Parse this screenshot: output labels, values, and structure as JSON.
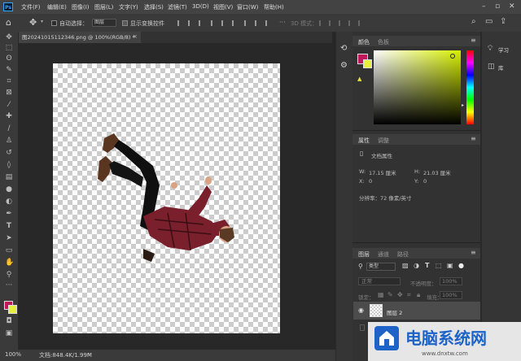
{
  "menu": {
    "logo": "Ps",
    "items": [
      "文件(F)",
      "编辑(E)",
      "图像(I)",
      "图层(L)",
      "文字(Y)",
      "选择(S)",
      "滤镜(T)",
      "3D(D)",
      "视图(V)",
      "窗口(W)",
      "帮助(H)"
    ]
  },
  "options": {
    "auto_select_label": "自动选择：",
    "auto_select_value": "图层",
    "show_transform_label": "显示变换控件",
    "mode_3d_label": "3D 模式："
  },
  "document": {
    "tab_title": "图20241015112346.png @ 100%(RGB/8) *"
  },
  "status": {
    "zoom": "100%",
    "doc_info": "文档:848.4K/1.99M"
  },
  "color_panel": {
    "tabs": [
      "颜色",
      "色板"
    ],
    "foreground": "#c0185a",
    "background": "#e6f03c",
    "field_hue": "#d7f000"
  },
  "properties_panel": {
    "tabs": [
      "属性",
      "调整"
    ],
    "doc_label": "文档属性",
    "w_label": "W:",
    "w_value": "17.15 厘米",
    "h_label": "H:",
    "h_value": "21.03 厘米",
    "x_label": "X:",
    "x_value": "0",
    "y_label": "Y:",
    "y_value": "0",
    "resolution": "分辨率：72 像素/英寸"
  },
  "layers_panel": {
    "tabs": [
      "图层",
      "通道",
      "路径"
    ],
    "kind_label": "类型",
    "blend_mode": "正常",
    "opacity_label": "不透明度：",
    "opacity_value": "100%",
    "lock_label": "锁定：",
    "fill_label": "填充：",
    "fill_value": "100%",
    "layers": [
      {
        "name": "图层 2"
      }
    ]
  },
  "right_panel": {
    "learn_label": "学习",
    "library_label": "库"
  },
  "watermark": {
    "text": "电脑系统网",
    "url": "www.dnxtw.com"
  }
}
